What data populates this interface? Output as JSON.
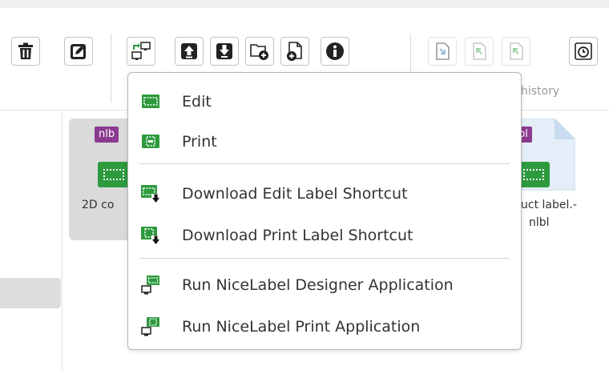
{
  "toolbar": {
    "buttons": [
      {
        "name": "delete-button",
        "icon": "trash-icon"
      },
      {
        "name": "rename-button",
        "icon": "edit-icon"
      },
      {
        "name": "open-with-button",
        "icon": "open-with-app-icon"
      },
      {
        "name": "upload-button",
        "icon": "upload-icon"
      },
      {
        "name": "download-button",
        "icon": "download-icon"
      },
      {
        "name": "new-folder-button",
        "icon": "new-folder-icon"
      },
      {
        "name": "new-file-button",
        "icon": "new-file-icon"
      },
      {
        "name": "info-button",
        "icon": "info-icon"
      },
      {
        "name": "check-in-button",
        "icon": "check-in-icon"
      },
      {
        "name": "check-out-button",
        "icon": "check-out-icon"
      },
      {
        "name": "undo-check-out-button",
        "icon": "undo-check-out-icon"
      },
      {
        "name": "history-button",
        "icon": "history-icon"
      }
    ],
    "group_label": "history"
  },
  "files": [
    {
      "tag": "nlb",
      "name": "2D co"
    },
    {
      "tag": "bl",
      "name_line1": "uct label.-",
      "name_line2": "nlbl"
    }
  ],
  "menu": {
    "items": [
      {
        "label": "Edit",
        "icon": "edit-label-icon"
      },
      {
        "label": "Print",
        "icon": "print-label-icon"
      },
      {
        "label": "Download Edit Label Shortcut",
        "icon": "download-edit-shortcut-icon"
      },
      {
        "label": "Download Print Label Shortcut",
        "icon": "download-print-shortcut-icon"
      },
      {
        "label": "Run NiceLabel Designer Application",
        "icon": "run-designer-icon"
      },
      {
        "label": "Run NiceLabel Print Application",
        "icon": "run-print-icon"
      }
    ]
  },
  "colors": {
    "accent_green": "#2e9a3e",
    "file_tag_purple": "#8b3b8f",
    "selection_gray": "#dadada"
  }
}
